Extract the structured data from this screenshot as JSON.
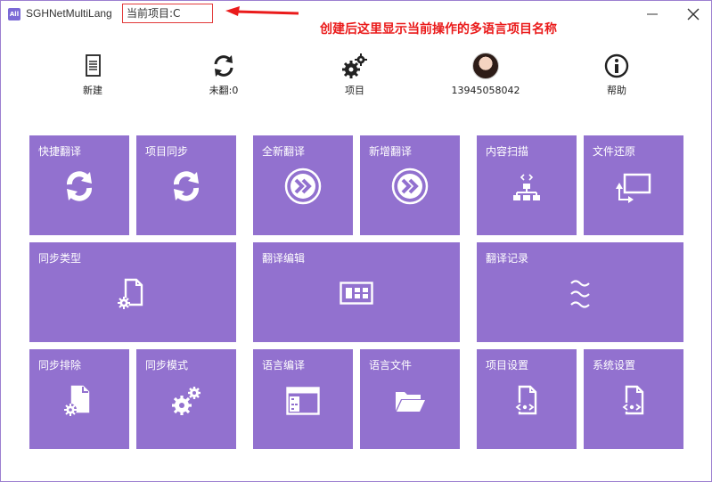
{
  "titlebar": {
    "app_logo": "All",
    "app_title": "SGHNetMultiLang",
    "current_project": "当前项目:C",
    "annotation": "创建后这里显示当前操作的多语言项目名称"
  },
  "toolbar": [
    {
      "label": "新建",
      "icon": "document-icon"
    },
    {
      "label": "未翻:0",
      "icon": "refresh-icon"
    },
    {
      "label": "项目",
      "icon": "gears-icon"
    },
    {
      "label": "13945058042",
      "icon": "avatar"
    },
    {
      "label": "帮助",
      "icon": "info-icon"
    }
  ],
  "tiles": {
    "quick_translate": "快捷翻译",
    "project_sync": "项目同步",
    "new_translate": "全新翻译",
    "add_translate": "新增翻译",
    "content_scan": "内容扫描",
    "file_restore": "文件还原",
    "sync_type": "同步类型",
    "translate_edit": "翻译编辑",
    "translate_log": "翻译记录",
    "sync_exclude": "同步排除",
    "sync_mode": "同步模式",
    "lang_compile": "语言编译",
    "lang_file": "语言文件",
    "project_settings": "项目设置",
    "system_settings": "系统设置"
  },
  "colors": {
    "tile": "#9271cf",
    "annotation": "#ea1b1b",
    "highlight_box": "#e23a3a"
  }
}
